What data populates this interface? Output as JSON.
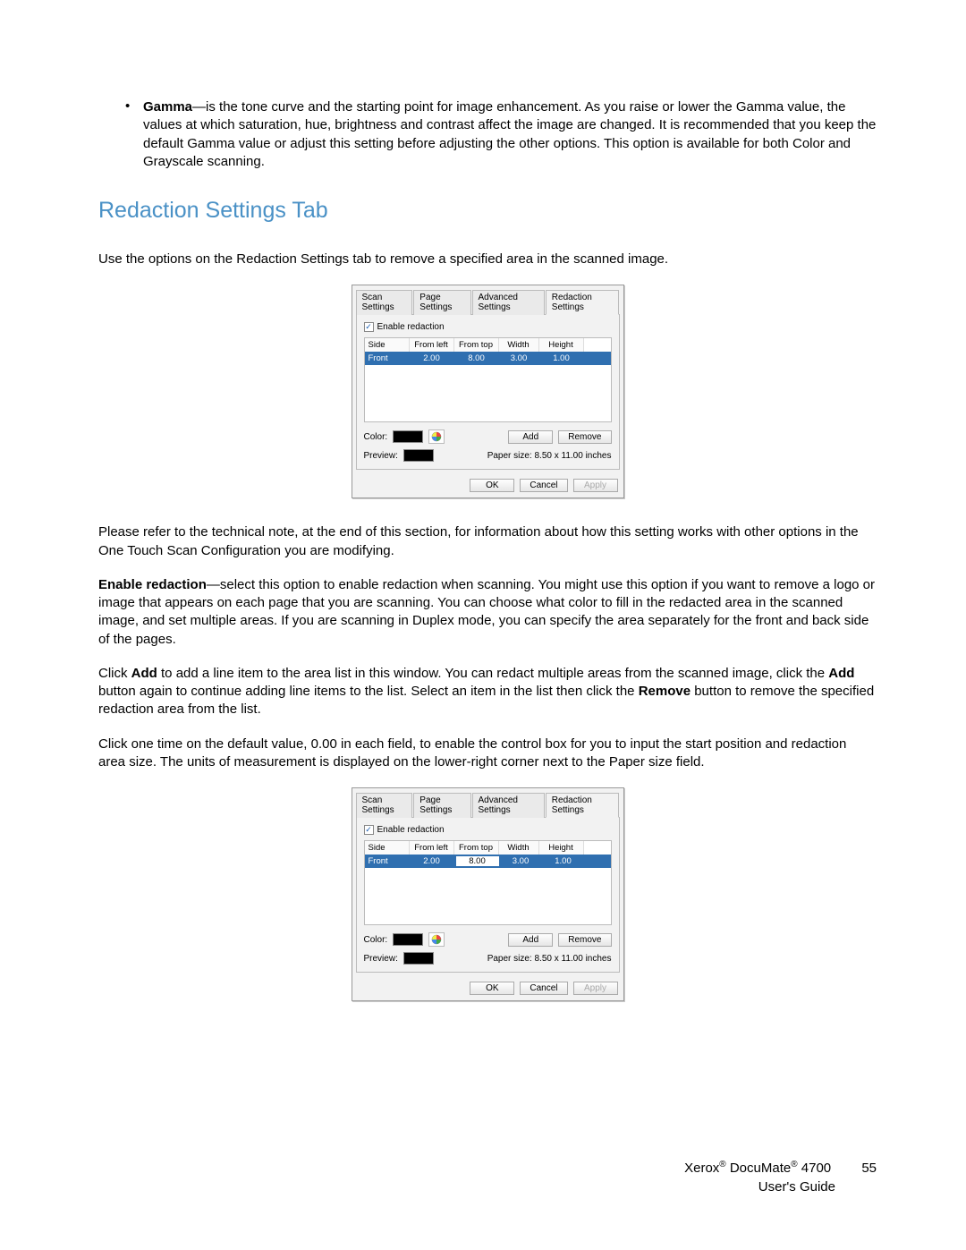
{
  "bullet": {
    "term": "Gamma",
    "text": "—is the tone curve and the starting point for image enhancement. As you raise or lower the Gamma value, the values at which saturation, hue, brightness and contrast affect the image are changed. It is recommended that you keep the default Gamma value or adjust this setting before adjusting the other options. This option is available for both Color and Grayscale scanning."
  },
  "heading": "Redaction Settings Tab",
  "intro": "Use the options on the Redaction Settings tab to remove a specified area in the scanned image.",
  "para1": "Please refer to the technical note, at the end of this section, for information about how this setting works with other options in the One Touch Scan Configuration you are modifying.",
  "para2_term": "Enable redaction",
  "para2_text": "—select this option to enable redaction when scanning. You might use this option if you want to remove a logo or image that appears on each page that you are scanning. You can choose what color to fill in the redacted area in the scanned image, and set multiple areas. If you are scanning in Duplex mode, you can specify the area separately for the front and back side of the pages.",
  "para3_pre": "Click ",
  "para3_b1": "Add",
  "para3_mid1": " to add a line item to the area list in this window. You can redact multiple areas from the scanned image, click the ",
  "para3_b2": "Add",
  "para3_mid2": " button again to continue adding line items to the list. Select an item in the list then click the ",
  "para3_b3": "Remove",
  "para3_post": " button to remove the specified redaction area from the list.",
  "para4": "Click one time on the default value, 0.00 in each field, to enable the control box for you to input the start position and redaction area size. The units of measurement is displayed on the lower-right corner next to the Paper size field.",
  "dialog": {
    "tabs": [
      "Scan Settings",
      "Page Settings",
      "Advanced Settings",
      "Redaction Settings"
    ],
    "activeTab": 3,
    "chk_label": "Enable redaction",
    "cols": {
      "side": "Side",
      "left": "From left",
      "top": "From top",
      "width": "Width",
      "height": "Height"
    },
    "row": {
      "side": "Front",
      "left": "2.00",
      "top": "8.00",
      "width": "3.00",
      "height": "1.00"
    },
    "color_label": "Color:",
    "preview_label": "Preview:",
    "paper_label": "Paper size:",
    "paper_value": "8.50 x 11.00 inches",
    "btn_add": "Add",
    "btn_remove": "Remove",
    "btn_ok": "OK",
    "btn_cancel": "Cancel",
    "btn_apply": "Apply"
  },
  "dialog2_edit_top": "8.00",
  "footer": {
    "line1a": "Xerox",
    "line1b": "DocuMate",
    "line1c": "4700",
    "page": "55",
    "line2": "User's Guide",
    "reg": "®"
  }
}
